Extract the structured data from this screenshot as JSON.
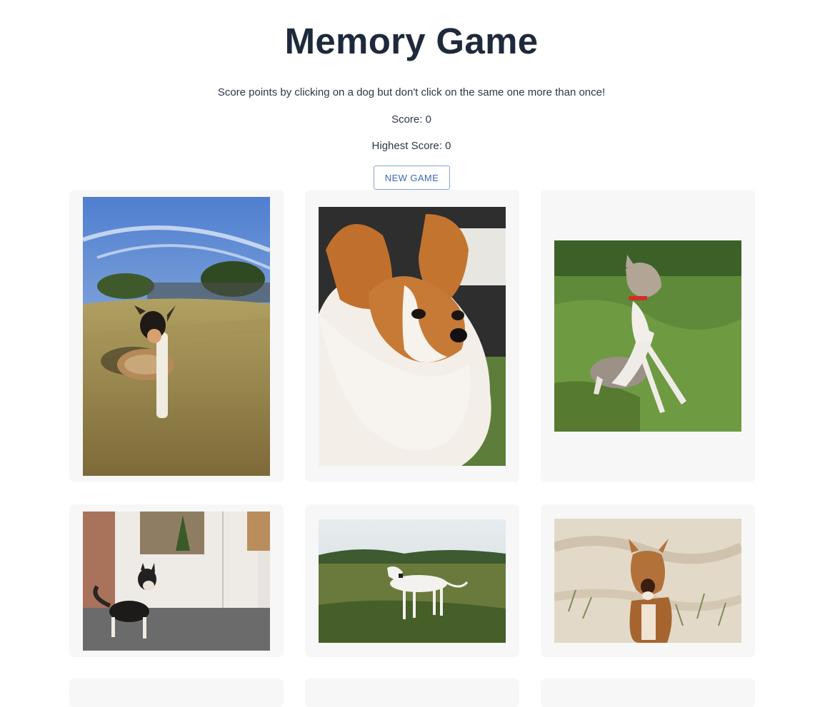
{
  "header": {
    "title": "Memory Game",
    "instructions": "Score points by clicking on a dog but don't click on the same one more than once!",
    "score_text": "Score: 0",
    "highest_score_text": "Highest Score: 0",
    "new_game_label": "NEW GAME"
  },
  "cards": [
    {
      "subject": "small black and tan dog holding frisbee on grass field"
    },
    {
      "subject": "papillon dog close-up portrait"
    },
    {
      "subject": "italian greyhound sitting on grass"
    },
    {
      "subject": "husky puppy standing indoors by door"
    },
    {
      "subject": "white whippet standing in tall grass field"
    },
    {
      "subject": "dingo sitting on sand"
    }
  ],
  "colors": {
    "title": "#1e2a3b",
    "card_background": "#f7f7f7",
    "button_border": "#8aa4c8",
    "button_text": "#3d6bb3"
  }
}
